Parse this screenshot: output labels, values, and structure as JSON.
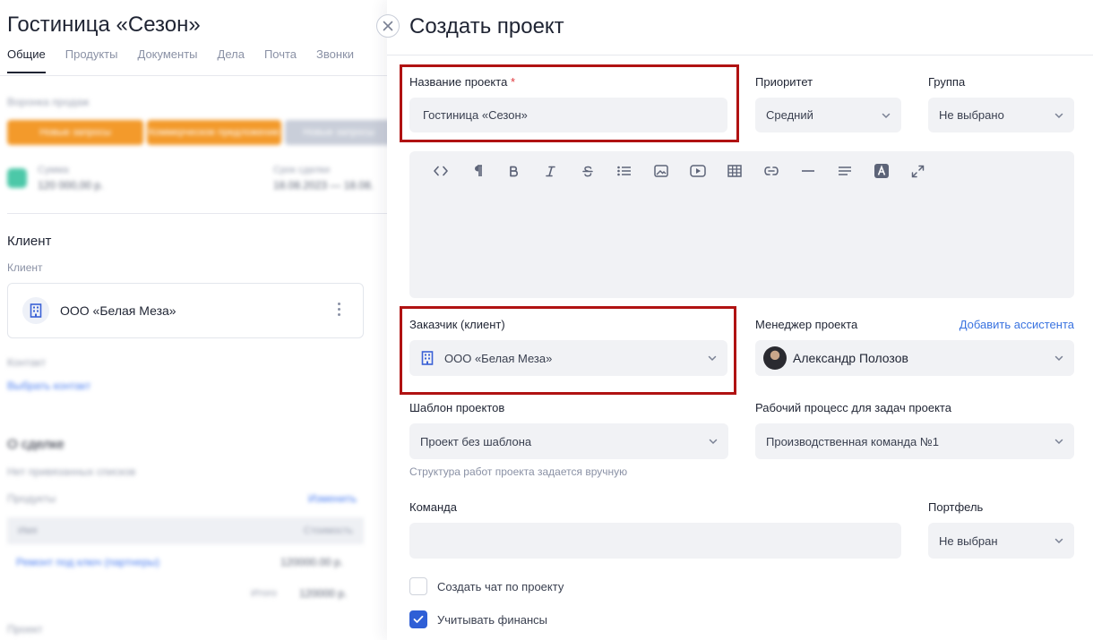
{
  "deal": {
    "title": "Гостиница «Сезон»",
    "tabs": [
      "Общие",
      "Продукты",
      "Документы",
      "Дела",
      "Почта",
      "Звонки"
    ],
    "funnel_label": "Воронка продаж",
    "stages": [
      "Новые запросы",
      "Коммерческое предложение",
      "Новые запросы"
    ],
    "sum_label": "Сумма",
    "sum_value": "120 000,00 р.",
    "deadline_label": "Срок сделки",
    "deadline_value": "18.08.2023 — 18.08.",
    "client_section": "Клиент",
    "client_label": "Клиент",
    "client_name": "ООО «Белая Меза»",
    "contact_label": "Контакт",
    "contact_link": "Выбрать контакт",
    "about_section": "О сделке",
    "no_lists": "Нет привязанных списков",
    "products_label": "Продукты",
    "edit_link": "Изменить",
    "col_name": "Имя",
    "col_cost": "Стоимость",
    "product_name": "Ремонт под ключ (партнеры)",
    "product_cost": "120000.00 р.",
    "total_label": "Итого",
    "total_value": "120000 р.",
    "more_label": "Проект"
  },
  "panel": {
    "title": "Создать проект",
    "name_label": "Название проекта",
    "required_mark": "*",
    "name_value": "Гостиница «Сезон»",
    "priority_label": "Приоритет",
    "priority_value": "Средний",
    "group_label": "Группа",
    "group_value": "Не выбрано",
    "customer_label": "Заказчик (клиент)",
    "customer_value": "ООО «Белая Меза»",
    "manager_label": "Менеджер проекта",
    "add_assistant": "Добавить ассистента",
    "manager_value": "Александр Полозов",
    "template_label": "Шаблон проектов",
    "template_value": "Проект без шаблона",
    "template_hint": "Структура работ проекта задается вручную",
    "workflow_label": "Рабочий процесс для задач проекта",
    "workflow_value": "Производственная команда №1",
    "team_label": "Команда",
    "portfolio_label": "Портфель",
    "portfolio_value": "Не выбран",
    "chat_checkbox_label": "Создать чат по проекту",
    "chat_checked": false,
    "finance_checkbox_label": "Учитывать финансы",
    "finance_checked": true
  },
  "editor_toolbar": [
    "code-icon",
    "paragraph-icon",
    "bold-icon",
    "italic-icon",
    "strikethrough-icon",
    "bullet-list-icon",
    "image-icon",
    "video-icon",
    "table-icon",
    "link-icon",
    "horizontal-rule-icon",
    "align-icon",
    "text-color-icon",
    "expand-icon"
  ],
  "colors": {
    "highlight": "#b01212",
    "accent": "#3a73e0",
    "checkbox_on": "#2f5fd6",
    "stage_orange": "#f39a2b"
  }
}
